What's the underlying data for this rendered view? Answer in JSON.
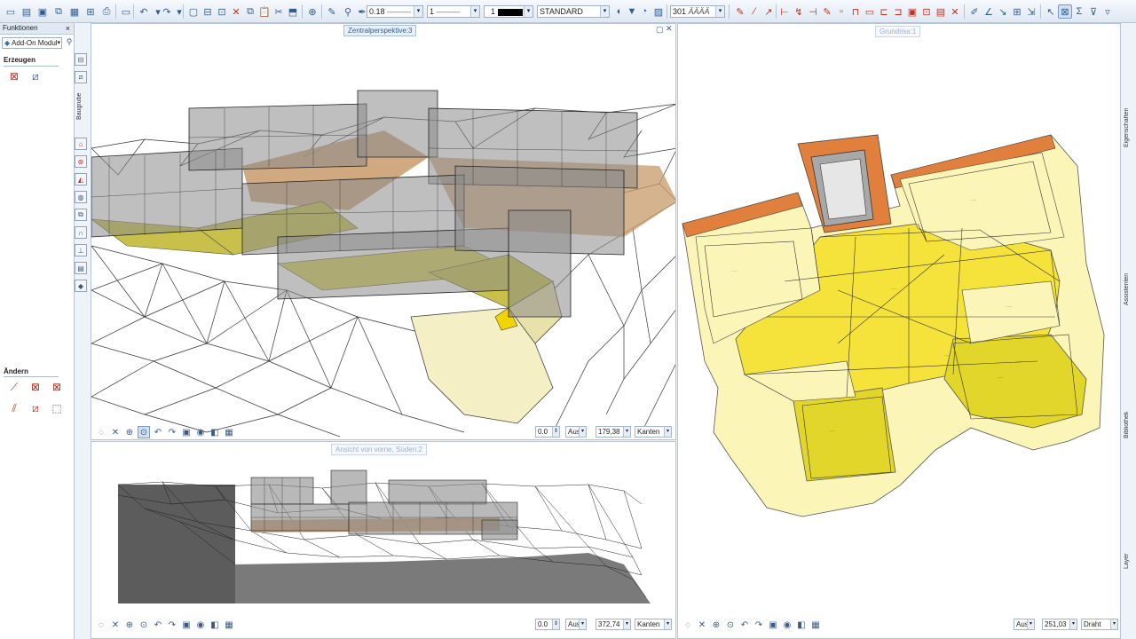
{
  "toolbar": {
    "pen_value": "0.18",
    "line_value": "1",
    "color_value": "1",
    "style_value": "STANDARD",
    "layer_value": "301",
    "layer_name": "ÄÄÄÄ"
  },
  "left_panel": {
    "title": "Funktionen",
    "module_label": "Add-On Modul",
    "section_create": "Erzeugen",
    "section_modify": "Ändern",
    "tab_label": "Baugrube"
  },
  "viewports": {
    "perspective": {
      "title": "Zentralperspektive:3",
      "angle_value": "0.0",
      "aus_label": "Aus",
      "scale_value": "179,38",
      "mode_value": "Kanten"
    },
    "front": {
      "title": "Ansicht von vorne, Süden:2",
      "angle_value": "0.0",
      "aus_label": "Aus",
      "scale_value": "372,74",
      "mode_value": "Kanten"
    },
    "plan": {
      "title": "Grundriss:1",
      "aus_label": "Aus",
      "scale_value": "251,03",
      "mode_value": "Draht"
    }
  },
  "right_strip": {
    "labels": [
      "Eigenschaften",
      "Assistenten",
      "Bibliothek",
      "Layer"
    ]
  },
  "colors": {
    "plan_yellow": "#f5e23a",
    "plan_cream": "#fbf6b8",
    "brick": "#e0803c",
    "glass_gray": "#8a8a8a"
  }
}
